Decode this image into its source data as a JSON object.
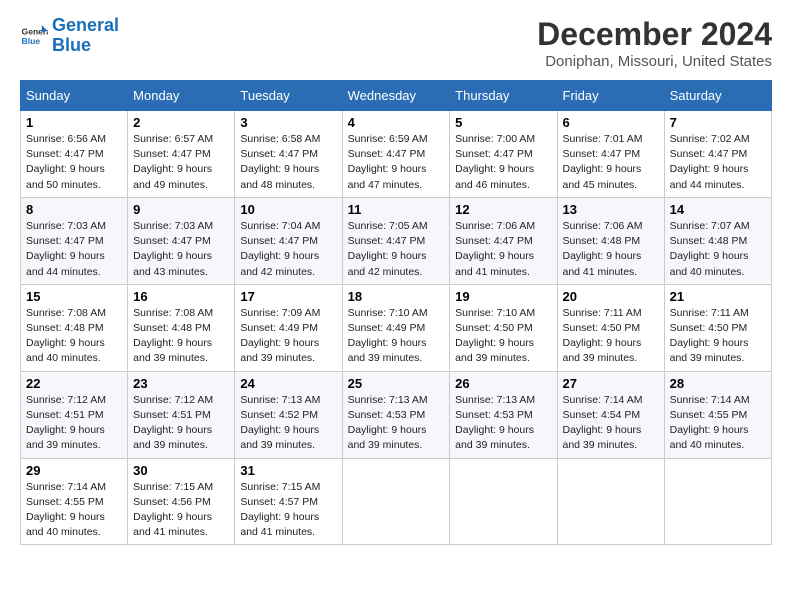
{
  "header": {
    "logo_line1": "General",
    "logo_line2": "Blue",
    "month_title": "December 2024",
    "location": "Doniphan, Missouri, United States"
  },
  "weekdays": [
    "Sunday",
    "Monday",
    "Tuesday",
    "Wednesday",
    "Thursday",
    "Friday",
    "Saturday"
  ],
  "weeks": [
    [
      {
        "day": "1",
        "sunrise": "Sunrise: 6:56 AM",
        "sunset": "Sunset: 4:47 PM",
        "daylight": "Daylight: 9 hours and 50 minutes."
      },
      {
        "day": "2",
        "sunrise": "Sunrise: 6:57 AM",
        "sunset": "Sunset: 4:47 PM",
        "daylight": "Daylight: 9 hours and 49 minutes."
      },
      {
        "day": "3",
        "sunrise": "Sunrise: 6:58 AM",
        "sunset": "Sunset: 4:47 PM",
        "daylight": "Daylight: 9 hours and 48 minutes."
      },
      {
        "day": "4",
        "sunrise": "Sunrise: 6:59 AM",
        "sunset": "Sunset: 4:47 PM",
        "daylight": "Daylight: 9 hours and 47 minutes."
      },
      {
        "day": "5",
        "sunrise": "Sunrise: 7:00 AM",
        "sunset": "Sunset: 4:47 PM",
        "daylight": "Daylight: 9 hours and 46 minutes."
      },
      {
        "day": "6",
        "sunrise": "Sunrise: 7:01 AM",
        "sunset": "Sunset: 4:47 PM",
        "daylight": "Daylight: 9 hours and 45 minutes."
      },
      {
        "day": "7",
        "sunrise": "Sunrise: 7:02 AM",
        "sunset": "Sunset: 4:47 PM",
        "daylight": "Daylight: 9 hours and 44 minutes."
      }
    ],
    [
      {
        "day": "8",
        "sunrise": "Sunrise: 7:03 AM",
        "sunset": "Sunset: 4:47 PM",
        "daylight": "Daylight: 9 hours and 44 minutes."
      },
      {
        "day": "9",
        "sunrise": "Sunrise: 7:03 AM",
        "sunset": "Sunset: 4:47 PM",
        "daylight": "Daylight: 9 hours and 43 minutes."
      },
      {
        "day": "10",
        "sunrise": "Sunrise: 7:04 AM",
        "sunset": "Sunset: 4:47 PM",
        "daylight": "Daylight: 9 hours and 42 minutes."
      },
      {
        "day": "11",
        "sunrise": "Sunrise: 7:05 AM",
        "sunset": "Sunset: 4:47 PM",
        "daylight": "Daylight: 9 hours and 42 minutes."
      },
      {
        "day": "12",
        "sunrise": "Sunrise: 7:06 AM",
        "sunset": "Sunset: 4:47 PM",
        "daylight": "Daylight: 9 hours and 41 minutes."
      },
      {
        "day": "13",
        "sunrise": "Sunrise: 7:06 AM",
        "sunset": "Sunset: 4:48 PM",
        "daylight": "Daylight: 9 hours and 41 minutes."
      },
      {
        "day": "14",
        "sunrise": "Sunrise: 7:07 AM",
        "sunset": "Sunset: 4:48 PM",
        "daylight": "Daylight: 9 hours and 40 minutes."
      }
    ],
    [
      {
        "day": "15",
        "sunrise": "Sunrise: 7:08 AM",
        "sunset": "Sunset: 4:48 PM",
        "daylight": "Daylight: 9 hours and 40 minutes."
      },
      {
        "day": "16",
        "sunrise": "Sunrise: 7:08 AM",
        "sunset": "Sunset: 4:48 PM",
        "daylight": "Daylight: 9 hours and 39 minutes."
      },
      {
        "day": "17",
        "sunrise": "Sunrise: 7:09 AM",
        "sunset": "Sunset: 4:49 PM",
        "daylight": "Daylight: 9 hours and 39 minutes."
      },
      {
        "day": "18",
        "sunrise": "Sunrise: 7:10 AM",
        "sunset": "Sunset: 4:49 PM",
        "daylight": "Daylight: 9 hours and 39 minutes."
      },
      {
        "day": "19",
        "sunrise": "Sunrise: 7:10 AM",
        "sunset": "Sunset: 4:50 PM",
        "daylight": "Daylight: 9 hours and 39 minutes."
      },
      {
        "day": "20",
        "sunrise": "Sunrise: 7:11 AM",
        "sunset": "Sunset: 4:50 PM",
        "daylight": "Daylight: 9 hours and 39 minutes."
      },
      {
        "day": "21",
        "sunrise": "Sunrise: 7:11 AM",
        "sunset": "Sunset: 4:50 PM",
        "daylight": "Daylight: 9 hours and 39 minutes."
      }
    ],
    [
      {
        "day": "22",
        "sunrise": "Sunrise: 7:12 AM",
        "sunset": "Sunset: 4:51 PM",
        "daylight": "Daylight: 9 hours and 39 minutes."
      },
      {
        "day": "23",
        "sunrise": "Sunrise: 7:12 AM",
        "sunset": "Sunset: 4:51 PM",
        "daylight": "Daylight: 9 hours and 39 minutes."
      },
      {
        "day": "24",
        "sunrise": "Sunrise: 7:13 AM",
        "sunset": "Sunset: 4:52 PM",
        "daylight": "Daylight: 9 hours and 39 minutes."
      },
      {
        "day": "25",
        "sunrise": "Sunrise: 7:13 AM",
        "sunset": "Sunset: 4:53 PM",
        "daylight": "Daylight: 9 hours and 39 minutes."
      },
      {
        "day": "26",
        "sunrise": "Sunrise: 7:13 AM",
        "sunset": "Sunset: 4:53 PM",
        "daylight": "Daylight: 9 hours and 39 minutes."
      },
      {
        "day": "27",
        "sunrise": "Sunrise: 7:14 AM",
        "sunset": "Sunset: 4:54 PM",
        "daylight": "Daylight: 9 hours and 39 minutes."
      },
      {
        "day": "28",
        "sunrise": "Sunrise: 7:14 AM",
        "sunset": "Sunset: 4:55 PM",
        "daylight": "Daylight: 9 hours and 40 minutes."
      }
    ],
    [
      {
        "day": "29",
        "sunrise": "Sunrise: 7:14 AM",
        "sunset": "Sunset: 4:55 PM",
        "daylight": "Daylight: 9 hours and 40 minutes."
      },
      {
        "day": "30",
        "sunrise": "Sunrise: 7:15 AM",
        "sunset": "Sunset: 4:56 PM",
        "daylight": "Daylight: 9 hours and 41 minutes."
      },
      {
        "day": "31",
        "sunrise": "Sunrise: 7:15 AM",
        "sunset": "Sunset: 4:57 PM",
        "daylight": "Daylight: 9 hours and 41 minutes."
      },
      null,
      null,
      null,
      null
    ]
  ]
}
